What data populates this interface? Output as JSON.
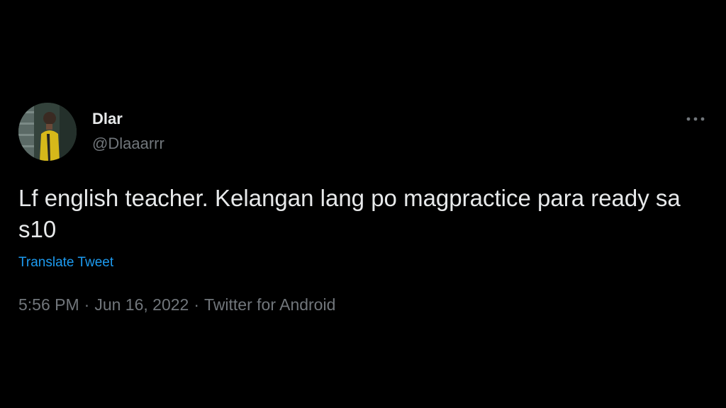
{
  "author": {
    "display_name": "Dlar",
    "handle": "@Dlaaarrr"
  },
  "tweet": {
    "text": "Lf english teacher. Kelangan lang po magpractice para ready sa s10",
    "translate_label": "Translate Tweet",
    "time": "5:56 PM",
    "date": "Jun 16, 2022",
    "source": "Twitter for Android",
    "separator": "·"
  },
  "icons": {
    "avatar": "profile-photo",
    "more": "more-horizontal-icon"
  },
  "colors": {
    "background": "#000000",
    "primary_text": "#e7e9ea",
    "secondary_text": "#71767b",
    "link": "#1d9bf0"
  }
}
